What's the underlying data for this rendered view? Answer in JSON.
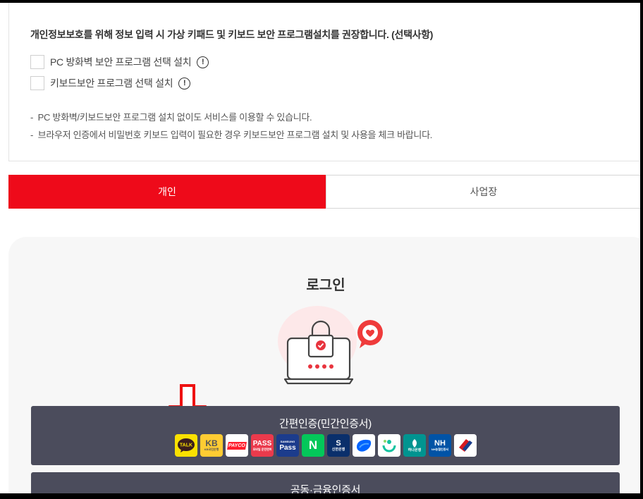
{
  "security_notice": {
    "title": "개인정보보호를 위해 정보 입력 시 가상 키패드 및 키보드 보안 프로그램설치를 권장합니다. (선택사항)",
    "options": [
      {
        "label": "PC 방화벽 보안 프로그램 선택 설치",
        "checked": false
      },
      {
        "label": "키보드보안 프로그램 선택 설치",
        "checked": false
      }
    ],
    "info_glyph": "!",
    "notes": [
      "PC 방화벽/키보드보안 프로그램 설치 없이도 서비스를 이용할 수 있습니다.",
      "브라우저 인증에서 비밀번호 키보드 입력이 필요한 경우 키보드보안 프로그램 설치 및 사용을 체크 바랍니다."
    ],
    "note_bullet": "-"
  },
  "tabs": [
    {
      "label": "개인",
      "active": true
    },
    {
      "label": "사업장",
      "active": false
    }
  ],
  "login": {
    "title": "로그인",
    "easy_auth_label": "간편인증(민간인증서)",
    "joint_auth_label": "공동·금융인증서",
    "providers": [
      {
        "name": "kakaotalk-icon",
        "text": "TALK",
        "bg": "#fae100",
        "fg": "#3a1d1d"
      },
      {
        "name": "kb-icon",
        "text": "KB",
        "subtext": "KB국민은행",
        "bg": "#ffcc33",
        "fg": "#555"
      },
      {
        "name": "payco-icon",
        "text": "PAYCO",
        "bg": "#ffffff",
        "fg": "#ff1f2d"
      },
      {
        "name": "pass-icon",
        "text": "PASS",
        "subtext": "모바일 운전면허",
        "bg": "#ea3a4c",
        "fg": "#ffffff"
      },
      {
        "name": "samsung-pass-icon",
        "text": "Pass",
        "subtext": "SAMSUNG",
        "bg": "#1c3c8c",
        "fg": "#ffffff"
      },
      {
        "name": "naver-icon",
        "text": "N",
        "bg": "#03c75a",
        "fg": "#ffffff"
      },
      {
        "name": "shinhan-icon",
        "text": "S",
        "subtext": "신한은행",
        "bg": "#0a2f6b",
        "fg": "#ffffff"
      },
      {
        "name": "toss-icon",
        "text": "",
        "bg": "#ffffff",
        "fg": "#0064ff"
      },
      {
        "name": "banksalad-icon",
        "text": "",
        "bg": "#ffffff",
        "fg": "#12c2a0"
      },
      {
        "name": "hana-icon",
        "text": "",
        "subtext": "하나은행",
        "bg": "#009490",
        "fg": "#ffffff"
      },
      {
        "name": "nh-icon",
        "text": "NH",
        "subtext": "NH농협인증서",
        "bg": "#0053a6",
        "fg": "#ffffff"
      },
      {
        "name": "woori-icon",
        "text": "",
        "bg": "#ffffff",
        "fg": "#d71920"
      }
    ]
  },
  "colors": {
    "brand_red": "#ee0a1a",
    "button_dark": "#4b4c5c",
    "card_bg": "#f7f7f7"
  }
}
